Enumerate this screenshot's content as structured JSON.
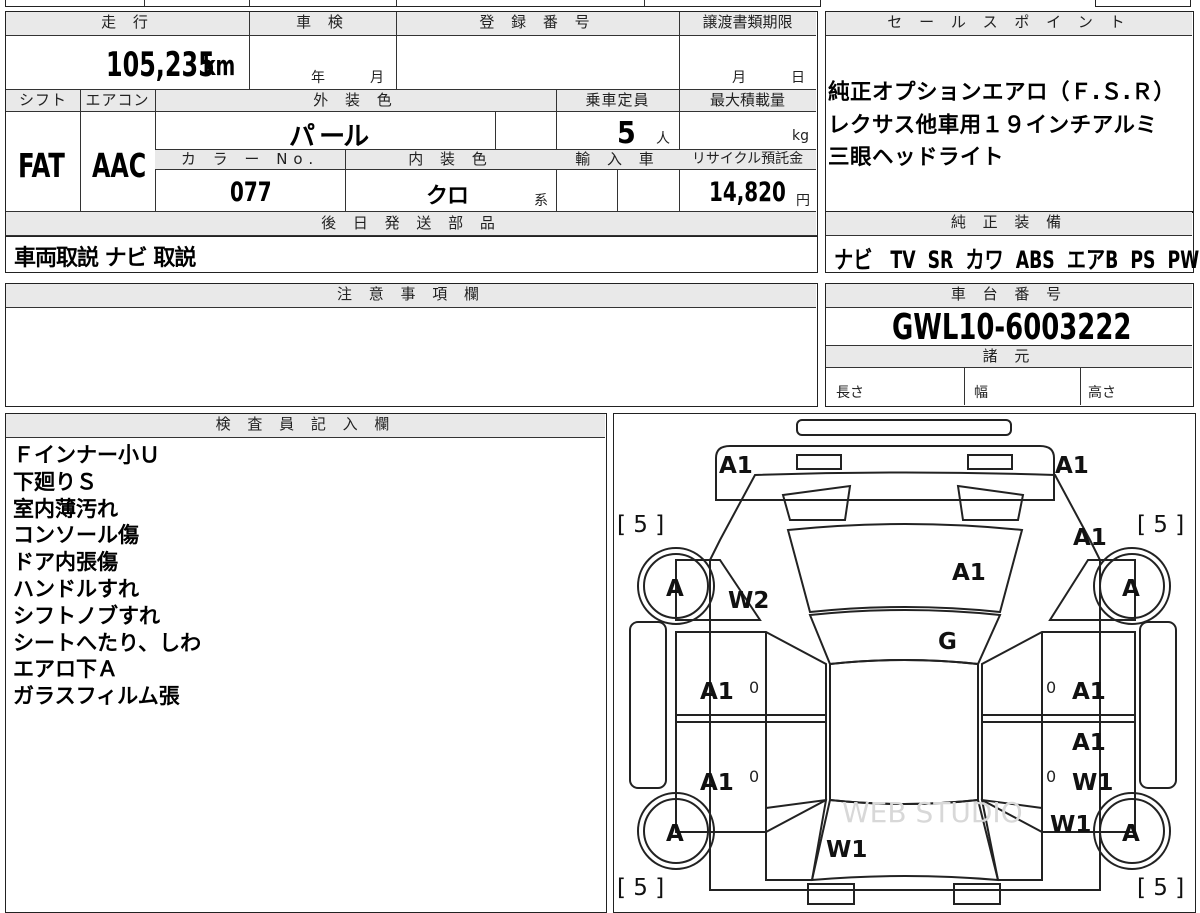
{
  "headers": {
    "mileage": "走 行",
    "inspection": "車 検",
    "registration": "登 録 番 号",
    "transfer_deadline": "譲渡書類期限",
    "sales_point": "セ ー ル ス ポ イ ン ト",
    "shift": "シフト",
    "ac": "エアコン",
    "ext_color": "外 装 色",
    "capacity": "乗車定員",
    "max_load": "最大積載量",
    "color_no": "カ ラ ー No.",
    "int_color": "内 装 色",
    "import": "輸 入 車",
    "recycle": "リサイクル預託金",
    "later_parts": "後 日 発 送 部 品",
    "genuine_equipment": "純 正 装 備",
    "notes": "注 意 事 項 欄",
    "chassis": "車 台 番 号",
    "specs": "諸 元",
    "inspector": "検 査 員 記 入 欄"
  },
  "vehicle": {
    "mileage_value": "105,235",
    "mileage_unit": "km",
    "inspection_year_unit": "年",
    "inspection_month_unit": "月",
    "transfer_month_unit": "月",
    "transfer_day_unit": "日",
    "shift": "FAT",
    "ac": "AAC",
    "ext_color": "パ ール",
    "capacity": "5",
    "capacity_unit": "人",
    "load_unit": "kg",
    "color_no": "077",
    "int_color": "クロ",
    "int_color_suffix": "系",
    "recycle_value": "14,820",
    "recycle_unit": "円",
    "later_parts": "車両取説 ナビ 取説",
    "equipment": "ナビ   TV  SR  カワ  ABS  エアB  PS  PW",
    "chassis_no": "GWL10-6003222",
    "spec_length": "長さ",
    "spec_width": "幅",
    "spec_height": "高さ"
  },
  "sales_points": [
    "純正オプションエアロ（Ｆ.Ｓ.Ｒ）",
    "レクサス他車用１９インチアルミ",
    "三眼ヘッドライト"
  ],
  "inspector_notes": [
    "Ｆインナー小Ｕ",
    "下廻りＳ",
    "室内薄汚れ",
    "コンソール傷",
    "ドア内張傷",
    "ハンドルすれ",
    "シフトノブすれ",
    "シートへたり、しわ",
    "エアロ下Ａ",
    "ガラスフィルム張"
  ],
  "diagram": {
    "bracket_top_left": "[ 5 ]",
    "bracket_top_right": "[ 5 ]",
    "bracket_bottom_left": "[ 5 ]",
    "bracket_bottom_right": "[ 5 ]",
    "front_left": "A1",
    "front_right": "A1",
    "right_front_fender": "A1",
    "hood": "A1",
    "windshield": "G",
    "left_wheel_top": "A",
    "right_wheel_top": "A",
    "left_fender": "W2",
    "left_front_door": "A1",
    "right_front_door": "A1",
    "left_rear_door": "A1",
    "right_rear_door_a": "A1",
    "right_rear_door_w": "W1",
    "right_quarter": "W1",
    "left_wheel_bottom": "A",
    "right_wheel_bottom": "A",
    "rear": "W1",
    "door_mark": "0",
    "watermark": "WEB STUDIO"
  }
}
